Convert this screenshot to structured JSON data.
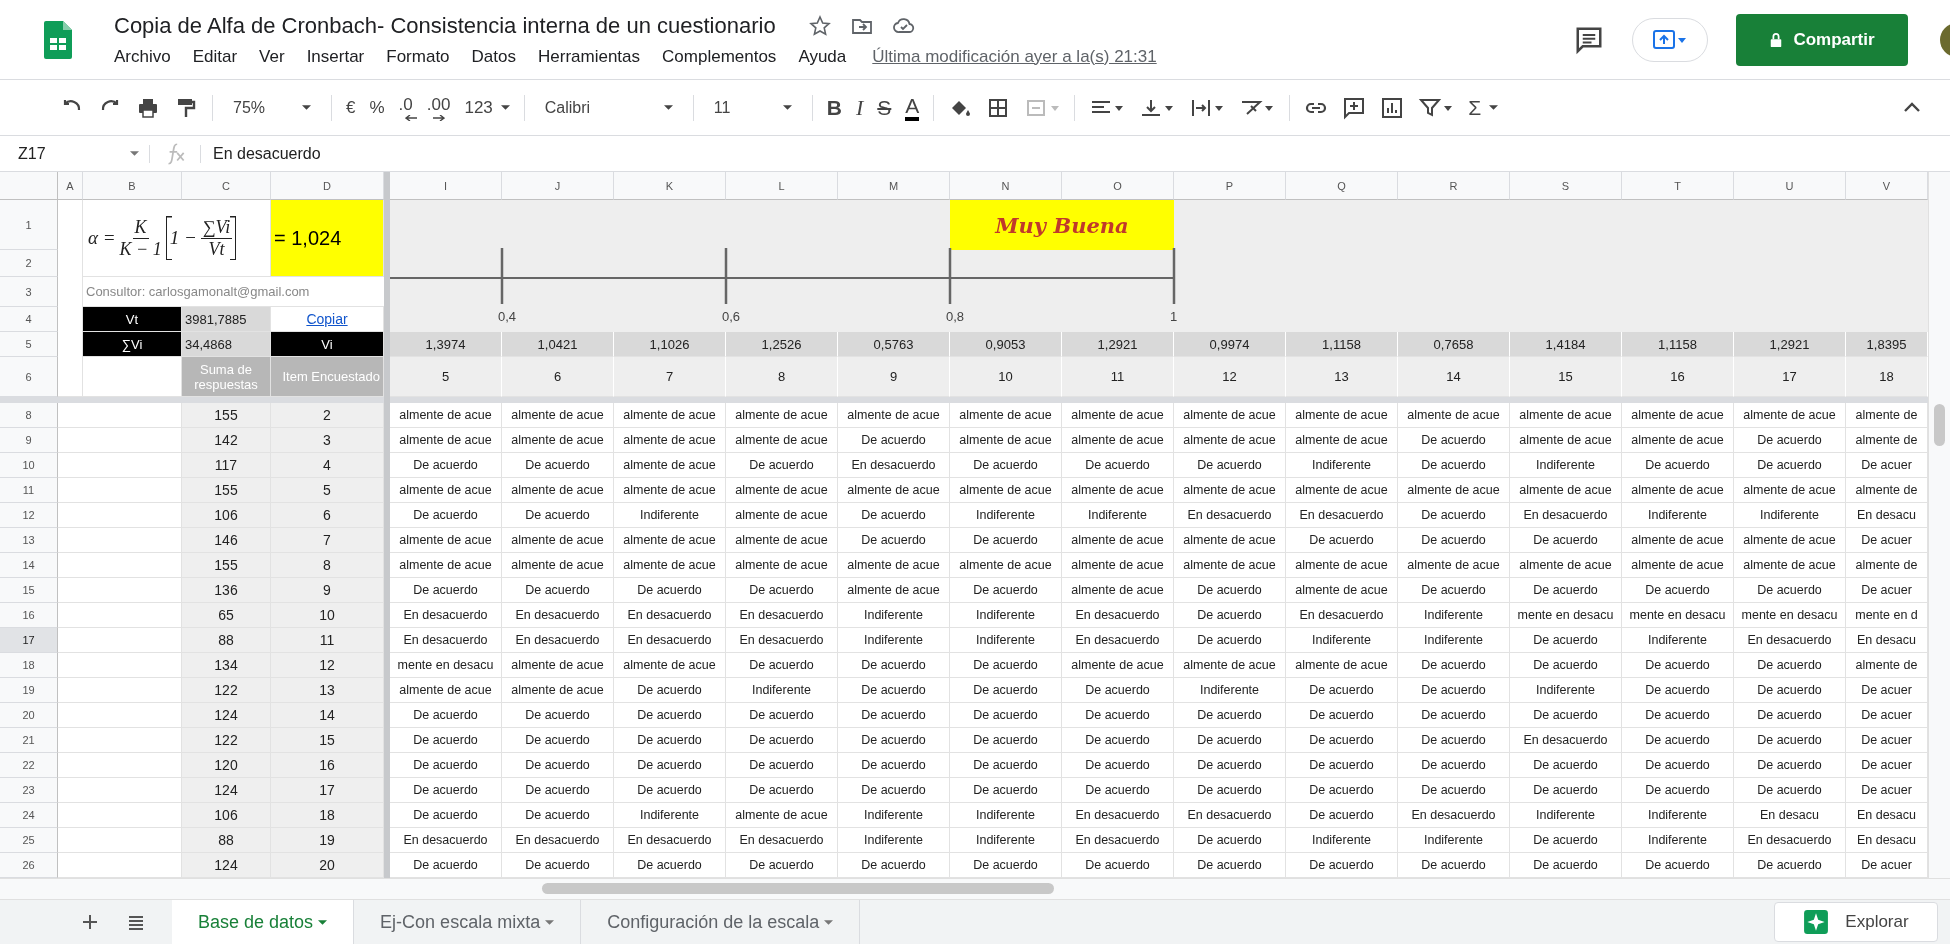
{
  "document": {
    "title": "Copia de Alfa de Cronbach- Consistencia interna de un cuestionario",
    "last_edit": "Última modificación ayer a la(s) 21:31"
  },
  "menu": [
    "Archivo",
    "Editar",
    "Ver",
    "Insertar",
    "Formato",
    "Datos",
    "Herramientas",
    "Complementos",
    "Ayuda"
  ],
  "share_button": "Compartir",
  "toolbar": {
    "zoom": "75%",
    "currency": "€",
    "percent": "%",
    "decrease_decimals": ".0",
    "increase_decimals": ".00",
    "number_format": "123",
    "font": "Calibri",
    "font_size": "11",
    "bold": "B",
    "italic": "I",
    "strikethrough": "S",
    "text_color": "A",
    "functions": "Σ"
  },
  "formula_bar": {
    "cell": "Z17",
    "value": "En desacuerdo"
  },
  "columns": [
    "A",
    "B",
    "C",
    "D",
    "I",
    "J",
    "K",
    "L",
    "M",
    "N",
    "O",
    "P",
    "Q",
    "R",
    "S",
    "T",
    "U",
    "V"
  ],
  "summary": {
    "formula": {
      "lhs": "α =",
      "k": "K",
      "k_minus_1": "K − 1",
      "one_minus": "1 −",
      "sum_vi": "∑Vi",
      "vt": "Vt"
    },
    "alpha": "= 1,024",
    "consultant": "Consultor: carlosgamonalt@gmail.com",
    "vt_label": "Vt",
    "vt_value": "3981,7885",
    "copy_link": "Copiar",
    "svi_label": "∑Vi",
    "svi_value": "34,4868",
    "vi_label": "Vi",
    "sum_heading": "Suma de respuestas",
    "item_heading": "Item Encuestado"
  },
  "scale": {
    "ticks": [
      "0,4",
      "0,6",
      "0,8",
      "1"
    ],
    "band_label": "Muy Buena"
  },
  "header_rows": [
    "1",
    "2",
    "3",
    "4",
    "5",
    "6"
  ],
  "vi_values": [
    "1,3974",
    "1,0421",
    "1,1026",
    "1,2526",
    "0,5763",
    "0,9053",
    "1,2921",
    "0,9974",
    "1,1158",
    "0,7658",
    "1,4184",
    "1,1158",
    "1,2921",
    "1,8395"
  ],
  "items": [
    "5",
    "6",
    "7",
    "8",
    "9",
    "10",
    "11",
    "12",
    "13",
    "14",
    "15",
    "16",
    "17",
    "18"
  ],
  "rows": [
    {
      "number": "8",
      "sum": "155",
      "item": "2",
      "selected": false,
      "cells": [
        "almente de acue",
        "almente de acue",
        "almente de acue",
        "almente de acue",
        "almente de acue",
        "almente de acue",
        "almente de acue",
        "almente de acue",
        "almente de acue",
        "almente de acue",
        "almente de acue",
        "almente de acue",
        "almente de acue",
        "almente de"
      ]
    },
    {
      "number": "9",
      "sum": "142",
      "item": "3",
      "selected": false,
      "cells": [
        "almente de acue",
        "almente de acue",
        "almente de acue",
        "almente de acue",
        "De acuerdo",
        "almente de acue",
        "almente de acue",
        "almente de acue",
        "almente de acue",
        "De acuerdo",
        "almente de acue",
        "almente de acue",
        "De acuerdo",
        "almente de"
      ]
    },
    {
      "number": "10",
      "sum": "117",
      "item": "4",
      "selected": false,
      "cells": [
        "De acuerdo",
        "De acuerdo",
        "almente de acue",
        "De acuerdo",
        "En desacuerdo",
        "De acuerdo",
        "De acuerdo",
        "De acuerdo",
        "Indiferente",
        "De acuerdo",
        "Indiferente",
        "De acuerdo",
        "De acuerdo",
        "De acuer"
      ]
    },
    {
      "number": "11",
      "sum": "155",
      "item": "5",
      "selected": false,
      "cells": [
        "almente de acue",
        "almente de acue",
        "almente de acue",
        "almente de acue",
        "almente de acue",
        "almente de acue",
        "almente de acue",
        "almente de acue",
        "almente de acue",
        "almente de acue",
        "almente de acue",
        "almente de acue",
        "almente de acue",
        "almente de"
      ]
    },
    {
      "number": "12",
      "sum": "106",
      "item": "6",
      "selected": false,
      "cells": [
        "De acuerdo",
        "De acuerdo",
        "Indiferente",
        "almente de acue",
        "De acuerdo",
        "Indiferente",
        "Indiferente",
        "En desacuerdo",
        "En desacuerdo",
        "De acuerdo",
        "En desacuerdo",
        "Indiferente",
        "Indiferente",
        "En desacu"
      ]
    },
    {
      "number": "13",
      "sum": "146",
      "item": "7",
      "selected": false,
      "cells": [
        "almente de acue",
        "almente de acue",
        "almente de acue",
        "almente de acue",
        "De acuerdo",
        "De acuerdo",
        "almente de acue",
        "almente de acue",
        "De acuerdo",
        "De acuerdo",
        "De acuerdo",
        "almente de acue",
        "almente de acue",
        "De acuer"
      ]
    },
    {
      "number": "14",
      "sum": "155",
      "item": "8",
      "selected": false,
      "cells": [
        "almente de acue",
        "almente de acue",
        "almente de acue",
        "almente de acue",
        "almente de acue",
        "almente de acue",
        "almente de acue",
        "almente de acue",
        "almente de acue",
        "almente de acue",
        "almente de acue",
        "almente de acue",
        "almente de acue",
        "almente de"
      ]
    },
    {
      "number": "15",
      "sum": "136",
      "item": "9",
      "selected": false,
      "cells": [
        "De acuerdo",
        "De acuerdo",
        "De acuerdo",
        "De acuerdo",
        "almente de acue",
        "De acuerdo",
        "almente de acue",
        "De acuerdo",
        "almente de acue",
        "De acuerdo",
        "De acuerdo",
        "De acuerdo",
        "De acuerdo",
        "De acuer"
      ]
    },
    {
      "number": "16",
      "sum": "65",
      "item": "10",
      "selected": false,
      "cells": [
        "En desacuerdo",
        "En desacuerdo",
        "En desacuerdo",
        "En desacuerdo",
        "Indiferente",
        "Indiferente",
        "En desacuerdo",
        "De acuerdo",
        "En desacuerdo",
        "Indiferente",
        "mente en desacu",
        "mente en desacu",
        "mente en desacu",
        "mente en d"
      ]
    },
    {
      "number": "17",
      "sum": "88",
      "item": "11",
      "selected": true,
      "cells": [
        "En desacuerdo",
        "En desacuerdo",
        "En desacuerdo",
        "En desacuerdo",
        "Indiferente",
        "Indiferente",
        "En desacuerdo",
        "De acuerdo",
        "Indiferente",
        "Indiferente",
        "De acuerdo",
        "Indiferente",
        "En desacuerdo",
        "En desacu"
      ]
    },
    {
      "number": "18",
      "sum": "134",
      "item": "12",
      "selected": false,
      "cells": [
        "mente en desacu",
        "almente de acue",
        "almente de acue",
        "De acuerdo",
        "De acuerdo",
        "De acuerdo",
        "almente de acue",
        "almente de acue",
        "almente de acue",
        "De acuerdo",
        "De acuerdo",
        "De acuerdo",
        "De acuerdo",
        "almente de"
      ]
    },
    {
      "number": "19",
      "sum": "122",
      "item": "13",
      "selected": false,
      "cells": [
        "almente de acue",
        "almente de acue",
        "De acuerdo",
        "Indiferente",
        "De acuerdo",
        "De acuerdo",
        "De acuerdo",
        "Indiferente",
        "De acuerdo",
        "De acuerdo",
        "Indiferente",
        "De acuerdo",
        "De acuerdo",
        "De acuer"
      ]
    },
    {
      "number": "20",
      "sum": "124",
      "item": "14",
      "selected": false,
      "cells": [
        "De acuerdo",
        "De acuerdo",
        "De acuerdo",
        "De acuerdo",
        "De acuerdo",
        "De acuerdo",
        "De acuerdo",
        "De acuerdo",
        "De acuerdo",
        "De acuerdo",
        "De acuerdo",
        "De acuerdo",
        "De acuerdo",
        "De acuer"
      ]
    },
    {
      "number": "21",
      "sum": "122",
      "item": "15",
      "selected": false,
      "cells": [
        "De acuerdo",
        "De acuerdo",
        "De acuerdo",
        "De acuerdo",
        "De acuerdo",
        "De acuerdo",
        "De acuerdo",
        "De acuerdo",
        "De acuerdo",
        "De acuerdo",
        "En desacuerdo",
        "De acuerdo",
        "De acuerdo",
        "De acuer"
      ]
    },
    {
      "number": "22",
      "sum": "120",
      "item": "16",
      "selected": false,
      "cells": [
        "De acuerdo",
        "De acuerdo",
        "De acuerdo",
        "De acuerdo",
        "De acuerdo",
        "De acuerdo",
        "De acuerdo",
        "De acuerdo",
        "De acuerdo",
        "De acuerdo",
        "De acuerdo",
        "De acuerdo",
        "De acuerdo",
        "De acuer"
      ]
    },
    {
      "number": "23",
      "sum": "124",
      "item": "17",
      "selected": false,
      "cells": [
        "De acuerdo",
        "De acuerdo",
        "De acuerdo",
        "De acuerdo",
        "De acuerdo",
        "De acuerdo",
        "De acuerdo",
        "De acuerdo",
        "De acuerdo",
        "De acuerdo",
        "De acuerdo",
        "De acuerdo",
        "De acuerdo",
        "De acuer"
      ]
    },
    {
      "number": "24",
      "sum": "106",
      "item": "18",
      "selected": false,
      "cells": [
        "De acuerdo",
        "De acuerdo",
        "Indiferente",
        "almente de acue",
        "Indiferente",
        "Indiferente",
        "En desacuerdo",
        "En desacuerdo",
        "De acuerdo",
        "En desacuerdo",
        "Indiferente",
        "Indiferente",
        "En desacu",
        "En desacu"
      ]
    },
    {
      "number": "25",
      "sum": "88",
      "item": "19",
      "selected": false,
      "cells": [
        "En desacuerdo",
        "En desacuerdo",
        "En desacuerdo",
        "En desacuerdo",
        "Indiferente",
        "Indiferente",
        "En desacuerdo",
        "De acuerdo",
        "Indiferente",
        "Indiferente",
        "De acuerdo",
        "Indiferente",
        "En desacuerdo",
        "En desacu"
      ]
    },
    {
      "number": "26",
      "sum": "124",
      "item": "20",
      "selected": false,
      "cells": [
        "De acuerdo",
        "De acuerdo",
        "De acuerdo",
        "De acuerdo",
        "De acuerdo",
        "De acuerdo",
        "De acuerdo",
        "De acuerdo",
        "De acuerdo",
        "De acuerdo",
        "De acuerdo",
        "De acuerdo",
        "De acuerdo",
        "De acuer"
      ]
    }
  ],
  "sheets": [
    {
      "label": "Base de datos",
      "selected": true
    },
    {
      "label": "Ej-Con escala mixta",
      "selected": false
    },
    {
      "label": "Configuración de la escala",
      "selected": false
    }
  ],
  "explore_button": "Explorar"
}
